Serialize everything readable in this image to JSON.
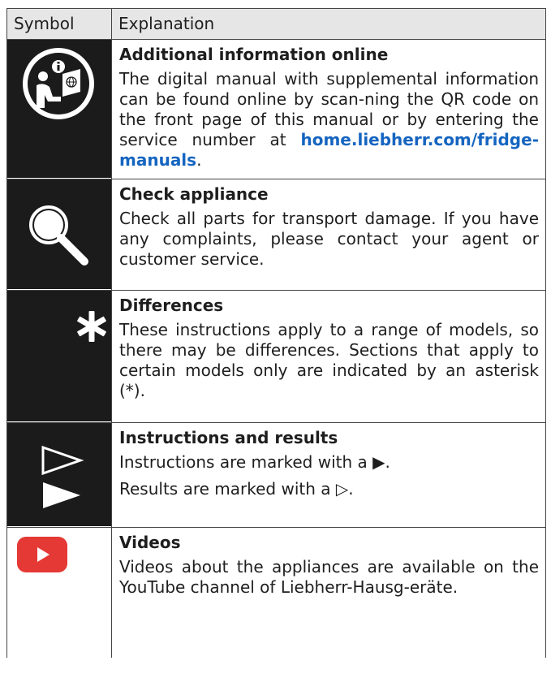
{
  "table": {
    "header": {
      "symbol": "Symbol",
      "explanation": "Explanation"
    },
    "rows": [
      {
        "icon": "online-info-icon",
        "title": "Additional information online",
        "text_before_link": "The digital manual with supplemental information can be found online by scan-ning the QR code on the front page of this manual or by entering the service number at ",
        "link": "home.liebherr.com/fridge-manuals",
        "text_after_link": "."
      },
      {
        "icon": "magnifier-icon",
        "title": "Check appliance",
        "text": "Check all parts for transport damage. If you have any complaints, please contact your agent or customer service."
      },
      {
        "icon": "asterisk-icon",
        "title": "Differences",
        "text": "These instructions apply to a range of models, so there may be differences. Sections that apply to certain models only are indicated by an asterisk (*)."
      },
      {
        "icon": "instruction-result-icon",
        "title": "Instructions and results",
        "line1": "Instructions are marked with a ▶.",
        "line2": "Results are marked with a ▷."
      },
      {
        "icon": "youtube-icon",
        "title": "Videos",
        "text": "Videos about the appliances are available on the YouTube channel of Liebherr-Hausg-eräte."
      }
    ]
  },
  "colors": {
    "link": "#1565c0",
    "youtube": "#e53935",
    "header_bg": "#e6e6e6",
    "icon_bg": "#1b1b1b"
  }
}
